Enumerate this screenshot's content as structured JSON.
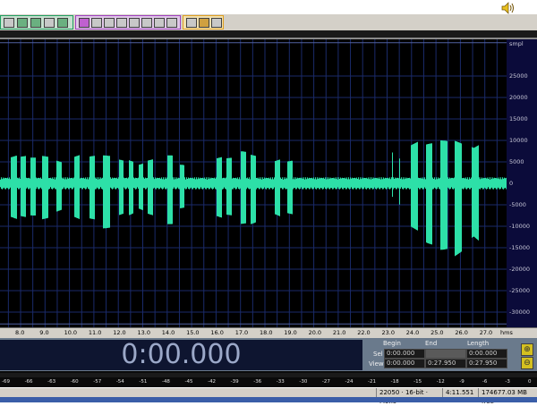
{
  "colors": {
    "waveform": "#2de0a8",
    "panel": "#000000",
    "grid": "#1a2a6a"
  },
  "icons": [
    "speaker-volume-icon",
    "zoom-in-icon",
    "zoom-out-icon"
  ],
  "time_ruler": {
    "labels": [
      "8.0",
      "9.0",
      "10.0",
      "11.0",
      "12.0",
      "13.0",
      "14.0",
      "15.0",
      "16.0",
      "17.0",
      "18.0",
      "19.0",
      "20.0",
      "21.0",
      "22.0",
      "23.0",
      "24.0",
      "25.0",
      "26.0",
      "27.0"
    ],
    "unit": "hms"
  },
  "amplitude_scale": {
    "unit": "smpl",
    "labels": [
      "25000",
      "20000",
      "15000",
      "10000",
      "5000",
      "0",
      "-5000",
      "-10000",
      "-15000",
      "-20000",
      "-25000",
      "-30000"
    ]
  },
  "display": {
    "time": "0:00.000"
  },
  "selection": {
    "headers": {
      "begin": "Begin",
      "end": "End",
      "length": "Length"
    },
    "sel": {
      "label": "Sel",
      "begin": "0:00.000",
      "end": "",
      "length": "0:00.000"
    },
    "view": {
      "label": "View",
      "begin": "0:00.000",
      "end": "0:27.950",
      "length": "0:27.950"
    }
  },
  "level_meter": {
    "labels": [
      "-69",
      "-66",
      "-63",
      "-60",
      "-57",
      "-54",
      "-51",
      "-48",
      "-45",
      "-42",
      "-39",
      "-36",
      "-33",
      "-30",
      "-27",
      "-24",
      "-21",
      "-18",
      "-15",
      "-12",
      "-9",
      "-6",
      "-3",
      "0"
    ],
    "unit": "dB"
  },
  "status_bar": {
    "format": "22050 · 16-bit · Mono",
    "size": "4:11.551",
    "free": "174677.03 MB free"
  }
}
